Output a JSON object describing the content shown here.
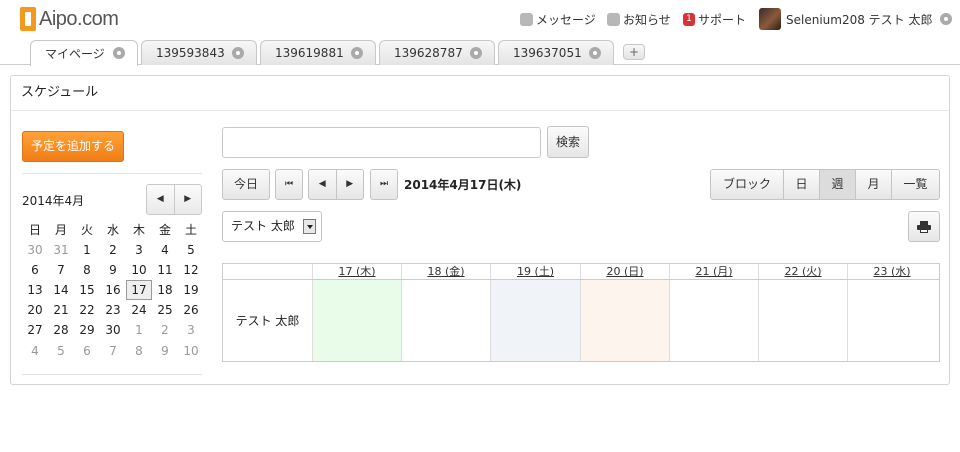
{
  "app": {
    "logo_text": "Aipo.com"
  },
  "topnav": {
    "messages": "メッセージ",
    "notices": "お知らせ",
    "support_badge": "1",
    "support": "サポート",
    "user_name": "Selenium208 テスト 太郎"
  },
  "tabs": [
    {
      "label": "マイページ"
    },
    {
      "label": "139593843"
    },
    {
      "label": "139619881"
    },
    {
      "label": "139628787"
    },
    {
      "label": "139637051"
    }
  ],
  "tab_add": "+",
  "panel": {
    "title": "スケジュール"
  },
  "add_button": "予定を追加する",
  "mini_calendar": {
    "month": "2014年4月",
    "prev": "◀",
    "next": "▶",
    "weekdays": [
      "日",
      "月",
      "火",
      "水",
      "木",
      "金",
      "土"
    ],
    "days": [
      {
        "d": "30",
        "muted": true
      },
      {
        "d": "31",
        "muted": true
      },
      {
        "d": "1"
      },
      {
        "d": "2"
      },
      {
        "d": "3"
      },
      {
        "d": "4"
      },
      {
        "d": "5"
      },
      {
        "d": "6"
      },
      {
        "d": "7"
      },
      {
        "d": "8"
      },
      {
        "d": "9"
      },
      {
        "d": "10"
      },
      {
        "d": "11"
      },
      {
        "d": "12"
      },
      {
        "d": "13"
      },
      {
        "d": "14"
      },
      {
        "d": "15"
      },
      {
        "d": "16"
      },
      {
        "d": "17",
        "today": true
      },
      {
        "d": "18"
      },
      {
        "d": "19"
      },
      {
        "d": "20"
      },
      {
        "d": "21"
      },
      {
        "d": "22"
      },
      {
        "d": "23"
      },
      {
        "d": "24"
      },
      {
        "d": "25"
      },
      {
        "d": "26"
      },
      {
        "d": "27"
      },
      {
        "d": "28"
      },
      {
        "d": "29"
      },
      {
        "d": "30"
      },
      {
        "d": "1",
        "muted": true
      },
      {
        "d": "2",
        "muted": true
      },
      {
        "d": "3",
        "muted": true
      },
      {
        "d": "4",
        "muted": true
      },
      {
        "d": "5",
        "muted": true
      },
      {
        "d": "6",
        "muted": true
      },
      {
        "d": "7",
        "muted": true
      },
      {
        "d": "8",
        "muted": true
      },
      {
        "d": "9",
        "muted": true
      },
      {
        "d": "10",
        "muted": true
      }
    ]
  },
  "search": {
    "value": "",
    "button": "検索"
  },
  "toolbar": {
    "today": "今日",
    "first": "⏮",
    "prev": "◀",
    "next": "▶",
    "last": "⏭",
    "current_date": "2014年4月17日(木)"
  },
  "view_modes": [
    {
      "label": "ブロック",
      "active": false
    },
    {
      "label": "日",
      "active": false
    },
    {
      "label": "週",
      "active": true
    },
    {
      "label": "月",
      "active": false
    },
    {
      "label": "一覧",
      "active": false
    }
  ],
  "user_select": {
    "selected": "テスト 太郎"
  },
  "week": {
    "days": [
      {
        "label": "17 (木)",
        "bg": "#e9fbe9"
      },
      {
        "label": "18 (金)",
        "bg": "#ffffff"
      },
      {
        "label": "19 (土)",
        "bg": "#f0f4f8"
      },
      {
        "label": "20 (日)",
        "bg": "#fdf4ee"
      },
      {
        "label": "21 (月)",
        "bg": "#ffffff"
      },
      {
        "label": "22 (火)",
        "bg": "#ffffff"
      },
      {
        "label": "23 (水)",
        "bg": "#ffffff"
      }
    ],
    "row_user": "テスト 太郎"
  },
  "colors": {
    "accent": "#f08a1c",
    "today_col": "#e9fbe9",
    "saturday": "#f0f4f8",
    "sunday": "#fdf4ee"
  }
}
